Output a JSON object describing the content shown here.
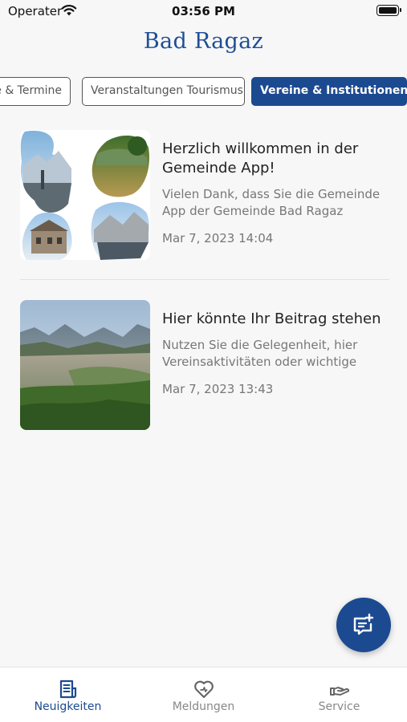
{
  "status_bar": {
    "carrier": "Operater",
    "time": "03:56 PM"
  },
  "header": {
    "title": "Bad Ragaz"
  },
  "categories": [
    {
      "label": "e & Termine",
      "active": false
    },
    {
      "label": "Veranstaltungen Tourismus",
      "active": false
    },
    {
      "label": "Vereine & Institutionen",
      "active": true
    }
  ],
  "news": [
    {
      "title": "Herzlich willkommen in der Gemeinde App!",
      "description": "Vielen Dank, dass Sie die Gemeinde App der Gemeinde Bad Ragaz",
      "date": "Mar 7, 2023 14:04"
    },
    {
      "title": "Hier könnte Ihr Beitrag stehen",
      "description": "Nutzen Sie die Gelegenheit, hier Vereinsaktivitäten oder wichtige",
      "date": "Mar 7, 2023 13:43"
    }
  ],
  "fab": {
    "icon": "add-post-icon"
  },
  "tab_bar": {
    "tabs": [
      {
        "label": "Neuigkeiten",
        "icon": "news-icon",
        "active": true
      },
      {
        "label": "Meldungen",
        "icon": "heart-report-icon",
        "active": false
      },
      {
        "label": "Service",
        "icon": "service-hand-icon",
        "active": false
      }
    ]
  },
  "colors": {
    "accent": "#1c4a91",
    "title": "#1f4e96",
    "background": "#f7f7f7"
  }
}
